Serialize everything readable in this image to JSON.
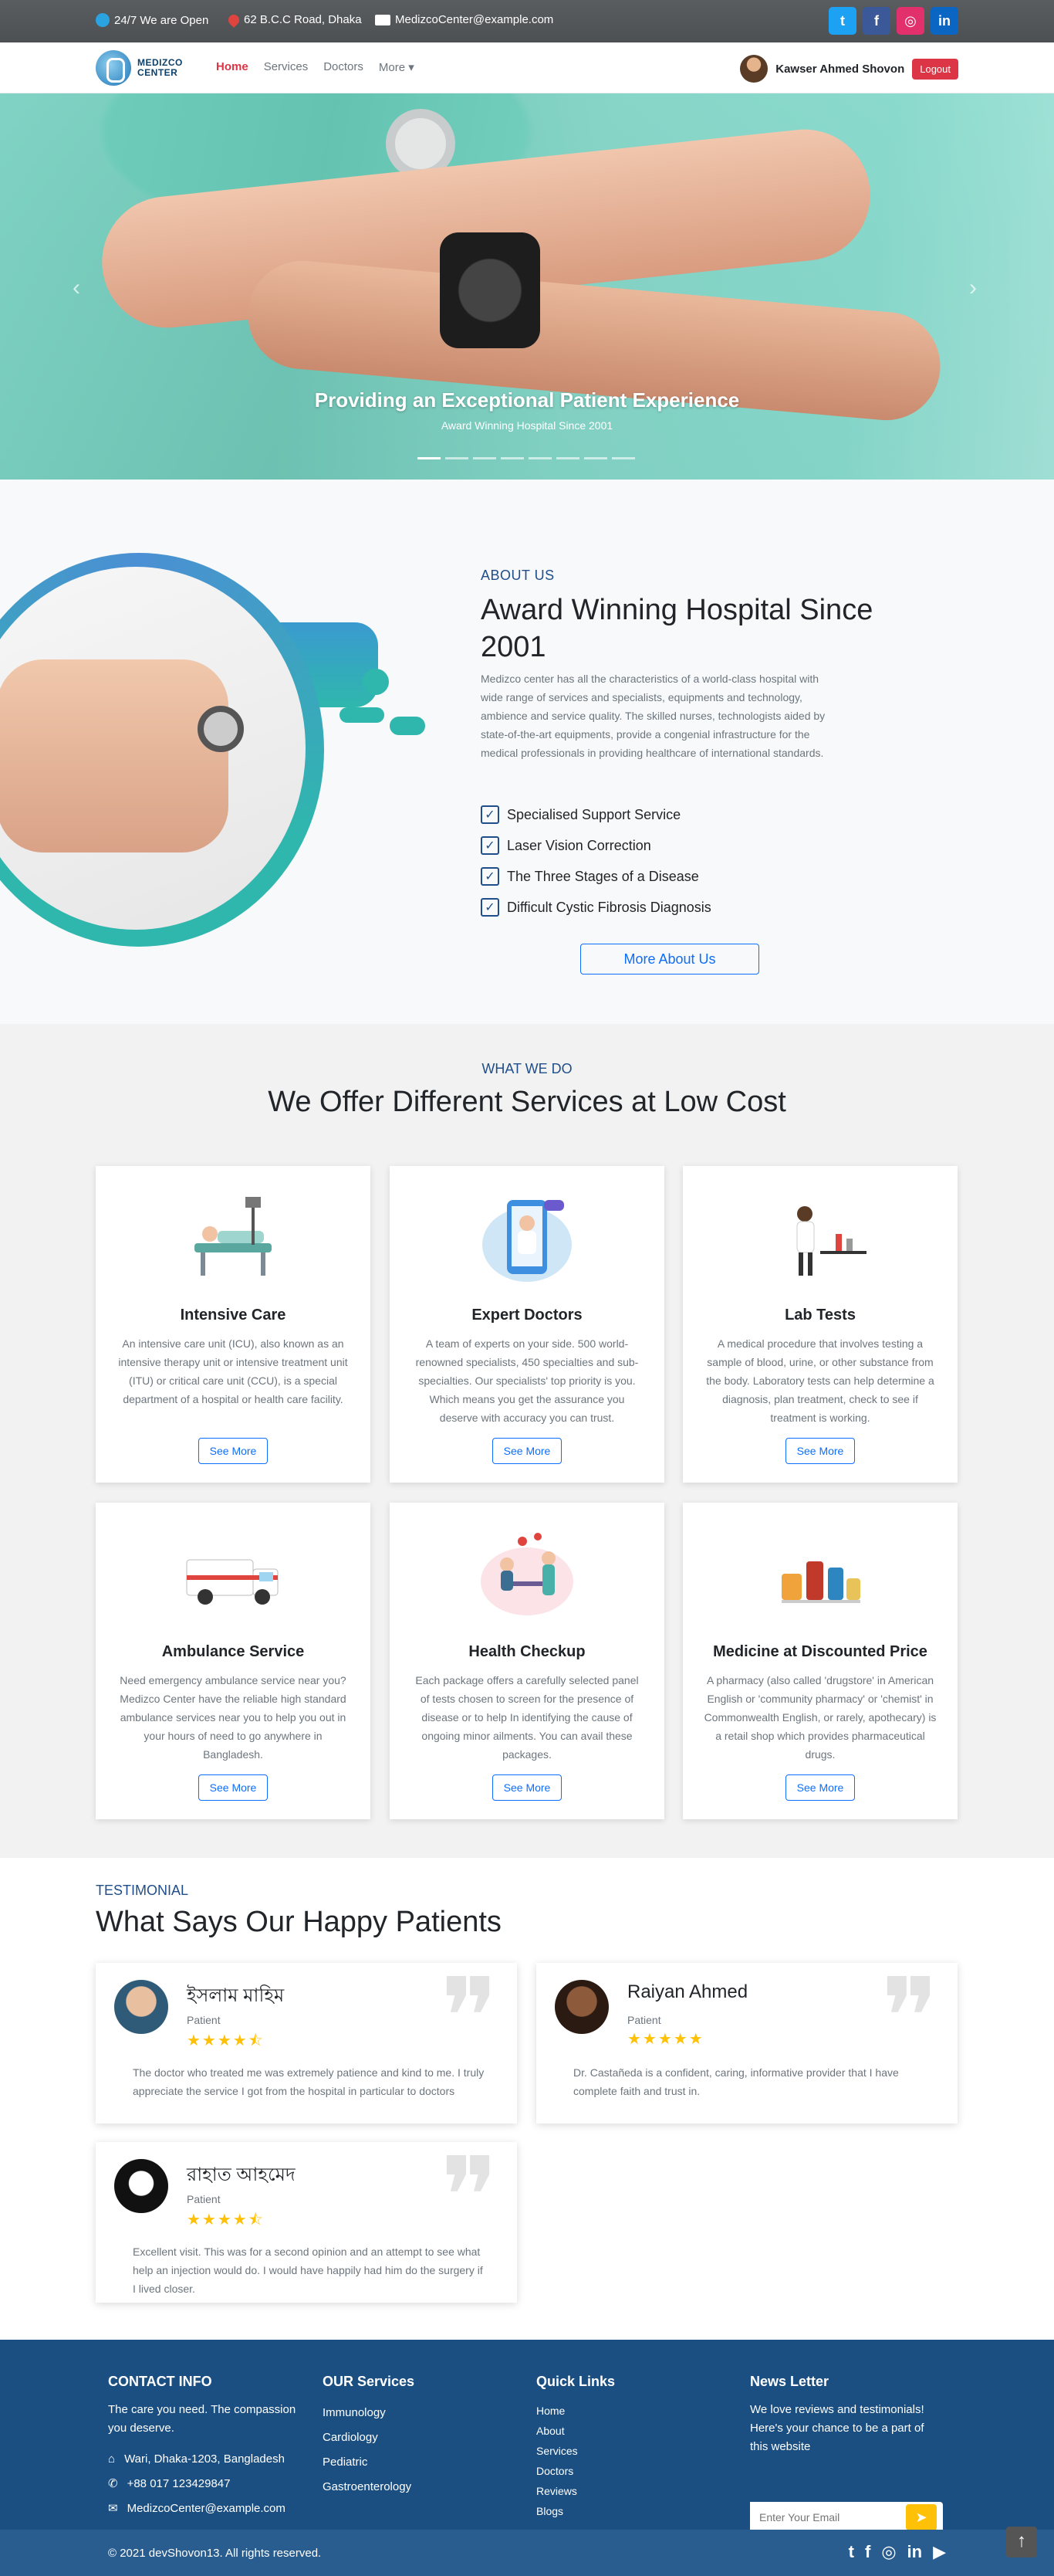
{
  "topbar": {
    "open": "24/7 We are Open",
    "address": "62 B.C.C Road, Dhaka",
    "email": "MedizcoCenter@example.com",
    "social": [
      "twitter-icon",
      "facebook-icon",
      "instagram-icon",
      "linkedin-icon"
    ]
  },
  "nav": {
    "logo_line1": "MEDIZCO",
    "logo_line2": "CENTER",
    "links": [
      "Home",
      "Services",
      "Doctors",
      "More ▾"
    ],
    "user": "Kawser Ahmed Shovon",
    "logout": "Logout"
  },
  "hero": {
    "title": "Providing an Exceptional Patient Experience",
    "subtitle": "Award Winning Hospital Since 2001",
    "slides": 8,
    "active_slide": 1
  },
  "about": {
    "sub": "ABOUT US",
    "title": "Award Winning Hospital Since 2001",
    "desc": "Medizco center has all the characteristics of a world-class hospital with wide range of services and specialists, equipments and technology, ambience and service quality. The skilled nurses, technologists aided by state-of-the-art equipments, provide a congenial infrastructure for the medical professionals in providing healthcare of international standards.",
    "checks": [
      "Specialised Support Service",
      "Laser Vision Correction",
      "The Three Stages of a Disease",
      "Difficult Cystic Fibrosis Diagnosis"
    ],
    "button": "More About Us"
  },
  "services": {
    "sub": "WHAT WE DO",
    "title": "We Offer Different Services at Low Cost",
    "button": "See More",
    "items": [
      {
        "title": "Intensive Care",
        "desc": "An intensive care unit (ICU), also known as an intensive therapy unit or intensive treatment unit (ITU) or critical care unit (CCU), is a special department of a hospital or health care facility."
      },
      {
        "title": "Expert Doctors",
        "desc": "A team of experts on your side. 500 world-renowned specialists, 450 specialties and sub-specialties. Our specialists' top priority is you. Which means you get the assurance you deserve with accuracy you can trust."
      },
      {
        "title": "Lab Tests",
        "desc": "A medical procedure that involves testing a sample of blood, urine, or other substance from the body. Laboratory tests can help determine a diagnosis, plan treatment, check to see if treatment is working."
      },
      {
        "title": "Ambulance Service",
        "desc": "Need emergency ambulance service near you? Medizco Center have the reliable high standard ambulance services near you to help you out in your hours of need to go anywhere in Bangladesh."
      },
      {
        "title": "Health Checkup",
        "desc": "Each package offers a carefully selected panel of tests chosen to screen for the presence of disease or to help In identifying the cause of ongoing minor ailments. You can avail these packages."
      },
      {
        "title": "Medicine at Discounted Price",
        "desc": "A pharmacy (also called 'drugstore' in American English or 'community pharmacy' or 'chemist' in Commonwealth English, or rarely, apothecary) is a retail shop which provides pharmaceutical drugs."
      }
    ]
  },
  "testimonials": {
    "sub": "TESTIMONIAL",
    "title": "What Says Our Happy Patients",
    "items": [
      {
        "name": "ইসলাম মাহিম",
        "role": "Patient",
        "rating": 4.5,
        "stars": "★★★★⯪",
        "text": "The doctor who treated me was extremely patience and kind to me. I truly appreciate the service I got from the hospital in particular to doctors"
      },
      {
        "name": "Raiyan Ahmed",
        "role": "Patient",
        "rating": 5,
        "stars": "★★★★★",
        "text": "Dr. Castañeda is a confident, caring, informative provider that I have complete faith and trust in."
      },
      {
        "name": "রাহাত আহমেদ",
        "role": "Patient",
        "rating": 4.5,
        "stars": "★★★★⯪",
        "text": "Excellent visit. This was for a second opinion and an attempt to see what help an injection would do. I would have happily had him do the surgery if I lived closer."
      }
    ]
  },
  "footer": {
    "contact_title": "CONTACT INFO",
    "contact_tagline": "The care you need. The compassion you deserve.",
    "address": "Wari, Dhaka-1203, Bangladesh",
    "phone": "+88 017 123429847",
    "email": "MedizcoCenter@example.com",
    "services_title": "OUR Services",
    "services": [
      "Immunology",
      "Cardiology",
      "Pediatric",
      "Gastroenterology"
    ],
    "links_title": "Quick Links",
    "links": [
      "Home",
      "About",
      "Services",
      "Doctors",
      "Reviews",
      "Blogs"
    ],
    "news_title": "News Letter",
    "news_text": "We love reviews and testimonials! Here's your chance to be a part of this website",
    "news_placeholder": "Enter Your Email",
    "copyright": "© 2021 devShovon13. All rights reserved."
  },
  "colors": {
    "accent_red": "#dc3545",
    "brand_blue": "#1f4e8a",
    "footer_blue": "#1b4f81",
    "star": "#ffc107"
  }
}
